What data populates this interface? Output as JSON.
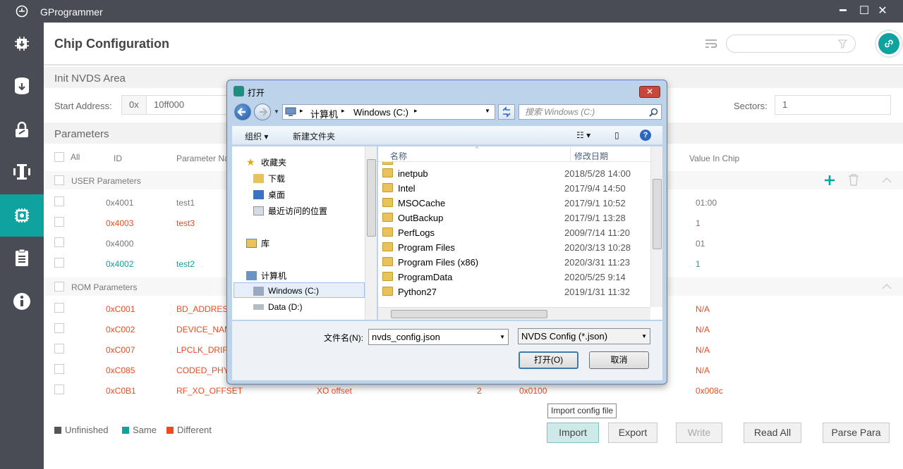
{
  "app": {
    "title": "GProgrammer"
  },
  "window_controls": {
    "minimize": "━",
    "maximize": "☐",
    "close": "✕"
  },
  "sidebar": {
    "items": [
      {
        "icon": "chip-download-icon",
        "active": false
      },
      {
        "icon": "database-download-icon",
        "active": false
      },
      {
        "icon": "lock-icon",
        "active": false
      },
      {
        "icon": "pin-tool-icon",
        "active": false
      },
      {
        "icon": "chip-config-icon",
        "active": true
      },
      {
        "icon": "clipboard-icon",
        "active": false
      },
      {
        "icon": "info-icon",
        "active": false
      }
    ]
  },
  "header": {
    "title": "Chip Configuration"
  },
  "nvds": {
    "title": "Init NVDS Area",
    "start_label": "Start Address:",
    "prefix": "0x",
    "start_value": "10ff000",
    "sectors_label": "Sectors:",
    "sectors_value": "1"
  },
  "params": {
    "title": "Parameters",
    "columns": {
      "all": "All",
      "id": "ID",
      "name": "Parameter Na",
      "value_in_chip": "Value In Chip"
    },
    "user_group": "USER Parameters",
    "rom_group": "ROM Parameters",
    "user_rows": [
      {
        "id": "0x4001",
        "name": "test1",
        "chip": "01:00",
        "status": "same-gray"
      },
      {
        "id": "0x4003",
        "name": "test3",
        "chip": "1",
        "status": "different"
      },
      {
        "id": "0x4000",
        "name": "",
        "chip": "01",
        "status": "same-gray"
      },
      {
        "id": "0x4002",
        "name": "test2",
        "chip": "1",
        "status": "same"
      }
    ],
    "rom_rows": [
      {
        "id": "0xC001",
        "name": "BD_ADDRESS",
        "desc": "",
        "len": "",
        "value": "",
        "chip": "N/A"
      },
      {
        "id": "0xC002",
        "name": "DEVICE_NAM",
        "desc": "",
        "len": "",
        "value": "",
        "chip": "N/A"
      },
      {
        "id": "0xC007",
        "name": "LPCLK_DRIFT",
        "desc": "",
        "len": "",
        "value": "",
        "chip": "N/A"
      },
      {
        "id": "0xC085",
        "name": "CODED_PHY_",
        "desc": "",
        "len": "",
        "value": "",
        "chip": "N/A"
      },
      {
        "id": "0xC0B1",
        "name": "RF_XO_OFFSET",
        "desc": "XO offset",
        "len": "2",
        "value": "0x0100",
        "chip": "0x008c"
      }
    ]
  },
  "legend": {
    "unfinished": "Unfinished",
    "same": "Same",
    "different": "Different",
    "colors": {
      "unfinished": "#555555",
      "same": "#0fa39f",
      "different": "#ef4a1e"
    }
  },
  "buttons": {
    "import": "Import",
    "export": "Export",
    "write": "Write",
    "read_all": "Read All",
    "parse_para": "Parse Para"
  },
  "tooltip": "Import config file",
  "dialog": {
    "title": "打开",
    "address": {
      "computer": "计算机",
      "drive": "Windows (C:)"
    },
    "search_placeholder": "搜索 Windows (C:)",
    "toolbar": {
      "organize": "组织 ▾",
      "new_folder": "新建文件夹"
    },
    "nav": {
      "favorites": "收藏夹",
      "downloads": "下载",
      "desktop": "桌面",
      "recent": "最近访问的位置",
      "library": "库",
      "computer": "计算机",
      "drive_c": "Windows (C:)",
      "drive_d": "Data (D:)"
    },
    "list_head": {
      "name": "名称",
      "date": "修改日期"
    },
    "files": [
      {
        "name": "inetpub",
        "date": "2018/5/28 14:00"
      },
      {
        "name": "Intel",
        "date": "2017/9/4 14:50"
      },
      {
        "name": "MSOCache",
        "date": "2017/9/1 10:52"
      },
      {
        "name": "OutBackup",
        "date": "2017/9/1 13:28"
      },
      {
        "name": "PerfLogs",
        "date": "2009/7/14 11:20"
      },
      {
        "name": "Program Files",
        "date": "2020/3/13 10:28"
      },
      {
        "name": "Program Files (x86)",
        "date": "2020/3/31 11:23"
      },
      {
        "name": "ProgramData",
        "date": "2020/5/25 9:14"
      },
      {
        "name": "Python27",
        "date": "2019/1/31 11:32"
      }
    ],
    "filename_label": "文件名(N):",
    "filename_value": "nvds_config.json",
    "filter_value": "NVDS Config (*.json)",
    "open_button": "打开(O)",
    "cancel_button": "取消"
  }
}
